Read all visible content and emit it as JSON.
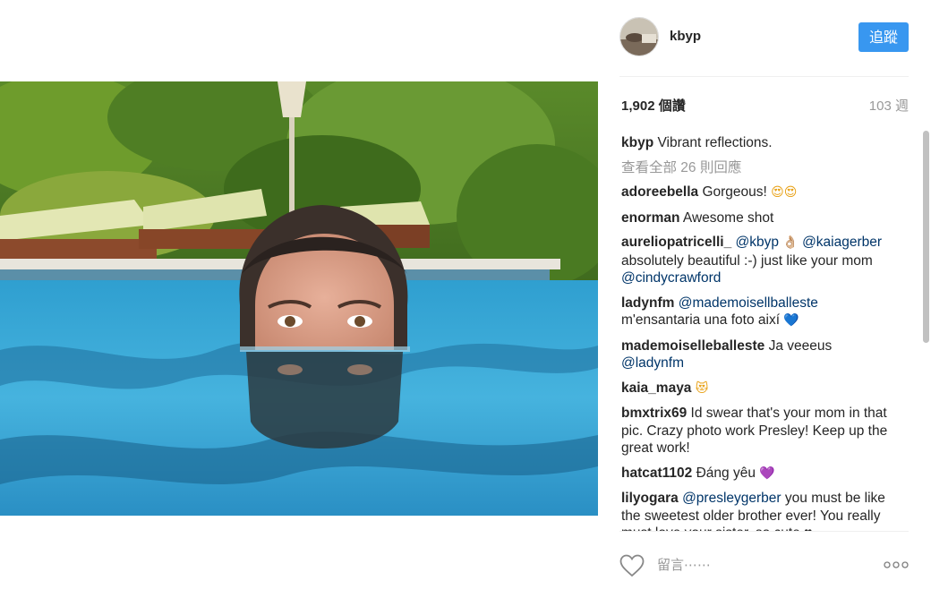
{
  "post": {
    "author": "kbyp",
    "follow_label": "追蹤",
    "views": "1,902 個讚",
    "age": "103 週"
  },
  "caption": {
    "user": "kbyp",
    "text": "Vibrant reflections."
  },
  "view_all_comments": "查看全部 26 則回應",
  "comments": [
    {
      "user": "adoreebella",
      "parts": [
        "Gorgeous! "
      ],
      "emoji": [
        "😍",
        "😍"
      ]
    },
    {
      "user": "enorman",
      "text": "Awesome shot"
    },
    {
      "user": "aureliopatricelli_",
      "m1": "@kbyp",
      "emoji": "👌🏼",
      "m2": "@kaiagerber",
      "text": "absolutely beautiful :-) just like your mom",
      "m3": "@cindycrawford"
    },
    {
      "user": "ladynfm",
      "m1": "@mademoisellballeste",
      "text": "m'ensantaria una foto així",
      "emoji": "💙"
    },
    {
      "user": "mademoiselleballeste",
      "text": "Ja veeeus",
      "m1": "@ladynfm"
    },
    {
      "user": "kaia_maya",
      "emoji": "😻"
    },
    {
      "user": "bmxtrix69",
      "text": "Id swear that's your mom in that pic. Crazy photo work Presley! Keep up the great work!"
    },
    {
      "user": "hatcat1102",
      "text": "Đáng yêu",
      "emoji": "💜"
    },
    {
      "user": "lilyogara",
      "m1": "@presleygerber",
      "text": "you must be like the sweetest older brother ever! You really must love your sister. so cute ♥"
    }
  ],
  "comment_input": {
    "placeholder": "留言⋯⋯"
  },
  "icons": {
    "like": "heart-outline-icon",
    "more": "more-options-icon",
    "avatar": "profile-avatar"
  },
  "colors": {
    "follow_button": "#3897f0",
    "text": "#262626",
    "muted": "#999999",
    "mention": "#003569"
  }
}
